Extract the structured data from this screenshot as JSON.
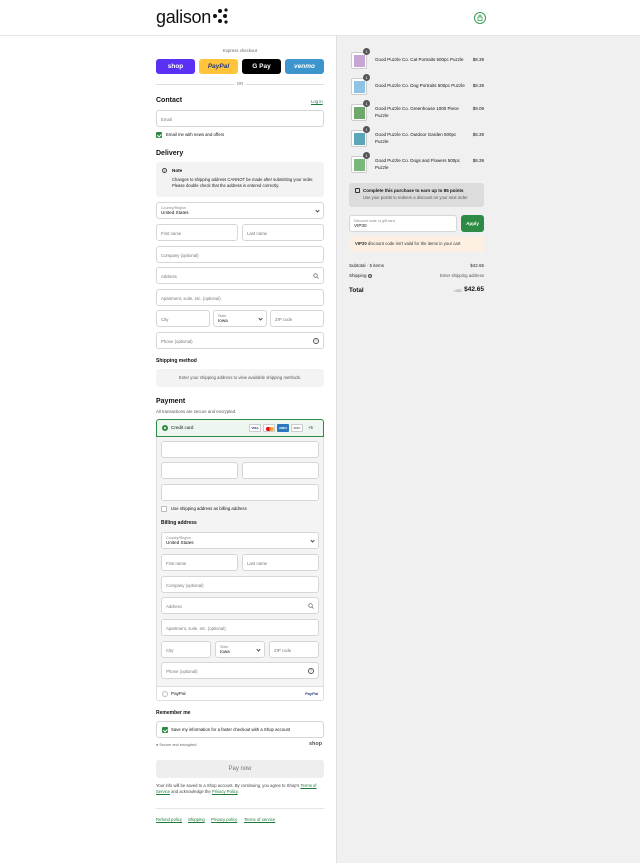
{
  "header": {
    "logo": "galison"
  },
  "express": {
    "label": "Express checkout",
    "buttons": [
      {
        "label": "shop",
        "bg": "#5a31f4",
        "fg": "#ffffff"
      },
      {
        "label": "PayPal",
        "bg": "#ffc439",
        "fg": "#253b80"
      },
      {
        "label": "G Pay",
        "bg": "#000000",
        "fg": "#ffffff"
      },
      {
        "label": "venmo",
        "bg": "#3d95ce",
        "fg": "#ffffff"
      }
    ],
    "or": "OR"
  },
  "contact": {
    "title": "Contact",
    "login": "Log in",
    "email_placeholder": "Email",
    "newsletter": "Email me with news and offers"
  },
  "delivery": {
    "title": "Delivery",
    "note_title": "Note",
    "note_text": "Changes to shipping address CANNOT be made after submitting your order. Please double check that the address is entered correctly.",
    "country_label": "Country/Region",
    "country": "United States",
    "first_name": "First name",
    "last_name": "Last name",
    "company": "Company (optional)",
    "address": "Address",
    "apartment": "Apartment, suite, etc. (optional)",
    "city": "City",
    "state_label": "State",
    "state": "Iowa",
    "zip": "ZIP code",
    "phone": "Phone (optional)"
  },
  "shipping_method": {
    "title": "Shipping method",
    "text": "Enter your shipping address to view available shipping methods."
  },
  "payment": {
    "title": "Payment",
    "subtitle": "All transactions are secure and encrypted.",
    "credit_card": "Credit card",
    "card_brands": [
      "VISA",
      "MC",
      "AMEX",
      "DISC"
    ],
    "more_cards": "+5",
    "use_shipping": "Use shipping address as billing address",
    "billing_title": "Billing address",
    "paypal": "PayPal",
    "paypal_logo": "PayPal"
  },
  "remember": {
    "title": "Remember me",
    "save_info": "Save my information for a faster checkout with a Shop account",
    "secure": "Secure and encrypted",
    "shop_logo": "shop"
  },
  "pay_now": "Pay now",
  "legal": {
    "line1": "Your info will be saved to a Shop account. By continuing, you agree to Shop's",
    "terms": "Terms of Service",
    "and": "and acknowledge the",
    "privacy": "Privacy Policy",
    "end": "."
  },
  "footer_links": [
    "Refund policy",
    "Shipping",
    "Privacy policy",
    "Terms of service"
  ],
  "cart": {
    "items": [
      {
        "name": "Good Puzzle Co. Cat Portraits 500pc Puzzle",
        "price": "$8.39",
        "qty": "1",
        "color": "#c7a6d6"
      },
      {
        "name": "Good Puzzle Co. Dog Portraits 500pc Puzzle",
        "price": "$8.39",
        "qty": "1",
        "color": "#8fc3e6"
      },
      {
        "name": "Good Puzzle Co. Greenhouse 1000 Piece Puzzle",
        "price": "$9.09",
        "qty": "1",
        "color": "#6fa86a"
      },
      {
        "name": "Good Puzzle Co. Outdoor Garden 500pc Puzzle",
        "price": "$8.39",
        "qty": "1",
        "color": "#5aa6b8"
      },
      {
        "name": "Good Puzzle Co. Dogs and Flowers 500pc Puzzle",
        "price": "$8.39",
        "qty": "1",
        "color": "#7ab87a"
      }
    ],
    "points_title": "Complete this purchase to earn up to 85 points",
    "points_sub": "Use your points to redeem a discount on your next order",
    "discount_label": "Discount code or gift card",
    "discount_value": "VIP30",
    "apply": "Apply",
    "error_code": "VIP30",
    "error_text": "discount code isn't valid for the items in your cart",
    "subtotal_label": "Subtotal · 5 items",
    "subtotal": "$42.65",
    "shipping_label": "Shipping",
    "shipping_value": "Enter shipping address",
    "total_label": "Total",
    "currency": "USD",
    "total": "$42.65"
  }
}
